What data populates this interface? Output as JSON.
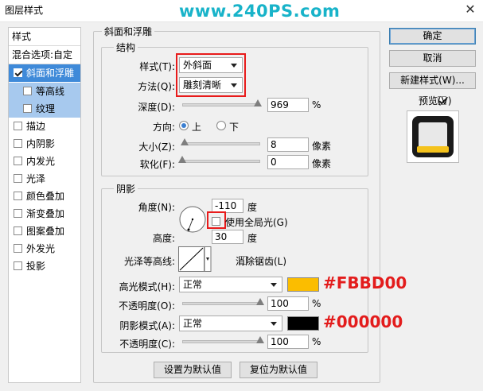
{
  "window": {
    "title": "图层样式",
    "watermark": "www.240PS.com"
  },
  "sidebar": {
    "header": "样式",
    "blend": "混合选项:自定",
    "items": [
      {
        "label": "斜面和浮雕",
        "checked": true
      },
      {
        "label": "等高线",
        "checked": false
      },
      {
        "label": "纹理",
        "checked": false
      },
      {
        "label": "描边",
        "checked": false
      },
      {
        "label": "内阴影",
        "checked": false
      },
      {
        "label": "内发光",
        "checked": false
      },
      {
        "label": "光泽",
        "checked": false
      },
      {
        "label": "颜色叠加",
        "checked": false
      },
      {
        "label": "渐变叠加",
        "checked": false
      },
      {
        "label": "图案叠加",
        "checked": false
      },
      {
        "label": "外发光",
        "checked": false
      },
      {
        "label": "投影",
        "checked": false
      }
    ]
  },
  "bevel": {
    "title": "斜面和浮雕",
    "structure": {
      "title": "结构",
      "style_label": "样式(T):",
      "style_value": "外斜面",
      "method_label": "方法(Q):",
      "method_value": "雕刻清晰",
      "depth_label": "深度(D):",
      "depth_value": "969",
      "depth_unit": "%",
      "depth_fraction": 0.97,
      "direction_label": "方向:",
      "dir_up": "上",
      "dir_down": "下",
      "size_label": "大小(Z):",
      "size_value": "8",
      "size_unit": "像素",
      "size_fraction": 0.03,
      "soften_label": "软化(F):",
      "soften_value": "0",
      "soften_unit": "像素",
      "soften_fraction": 0.0
    },
    "shading": {
      "title": "阴影",
      "angle_label": "角度(N):",
      "angle_value": "-110",
      "angle_unit": "度",
      "global_light_label": "使用全局光(G)",
      "altitude_label": "高度:",
      "altitude_value": "30",
      "altitude_unit": "度",
      "gloss_label": "光泽等高线:",
      "antialias_label": "消除锯齿(L)",
      "highlight_label": "高光模式(H):",
      "highlight_mode": "正常",
      "highlight_color": "#FBBD00",
      "highlight_hex": "#FBBD00",
      "hl_opacity_label": "不透明度(O):",
      "hl_opacity_value": "100",
      "hl_opacity_unit": "%",
      "hl_opacity_fraction": 1.0,
      "shadow_label": "阴影模式(A):",
      "shadow_mode": "正常",
      "shadow_color": "#000000",
      "shadow_hex": "#000000",
      "sh_opacity_label": "不透明度(C):",
      "sh_opacity_value": "100",
      "sh_opacity_unit": "%",
      "sh_opacity_fraction": 1.0
    },
    "set_default": "设置为默认值",
    "reset_default": "复位为默认值"
  },
  "actions": {
    "ok": "确定",
    "cancel": "取消",
    "new_style": "新建样式(W)...",
    "preview_label": "预览(V)",
    "preview_checked": true
  }
}
